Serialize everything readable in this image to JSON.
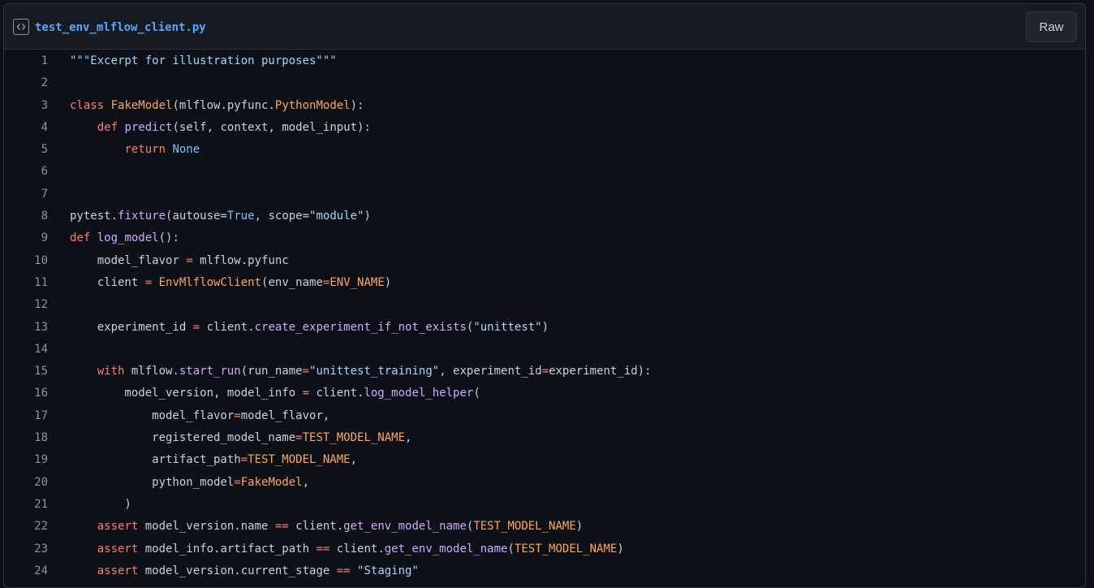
{
  "header": {
    "filename": "test_env_mlflow_client.py",
    "raw_label": "Raw",
    "file_icon": "code-icon"
  },
  "colors": {
    "background": "#0d1117",
    "header_bg": "#161b22",
    "border": "#30363d",
    "filename": "#58a6ff",
    "keyword": "#ff7b72",
    "function": "#d2a8ff",
    "class": "#ffa657",
    "string": "#a5d6ff",
    "constant": "#79c0ff",
    "text": "#c9d1d9",
    "line_number": "#8b949e"
  },
  "lines": [
    {
      "n": "1",
      "tokens": [
        {
          "t": "\"\"\"Excerpt for illustration purposes\"\"\"",
          "c": "str"
        }
      ]
    },
    {
      "n": "2",
      "tokens": []
    },
    {
      "n": "3",
      "tokens": [
        {
          "t": "class",
          "c": "kw"
        },
        {
          "t": " "
        },
        {
          "t": "FakeModel",
          "c": "cls"
        },
        {
          "t": "(mlflow.pyfunc."
        },
        {
          "t": "PythonModel",
          "c": "cls"
        },
        {
          "t": "):"
        }
      ]
    },
    {
      "n": "4",
      "tokens": [
        {
          "t": "    "
        },
        {
          "t": "def",
          "c": "kw"
        },
        {
          "t": " "
        },
        {
          "t": "predict",
          "c": "fn"
        },
        {
          "t": "(self, context, model_input):"
        }
      ]
    },
    {
      "n": "5",
      "tokens": [
        {
          "t": "        "
        },
        {
          "t": "return",
          "c": "kw"
        },
        {
          "t": " "
        },
        {
          "t": "None",
          "c": "const"
        }
      ]
    },
    {
      "n": "6",
      "tokens": []
    },
    {
      "n": "7",
      "tokens": []
    },
    {
      "n": "8",
      "tokens": [
        {
          "t": "pytest."
        },
        {
          "t": "fixture",
          "c": "fn"
        },
        {
          "t": "(autouse="
        },
        {
          "t": "True",
          "c": "const"
        },
        {
          "t": ", scope="
        },
        {
          "t": "\"module\"",
          "c": "str"
        },
        {
          "t": ")"
        }
      ]
    },
    {
      "n": "9",
      "tokens": [
        {
          "t": "def",
          "c": "kw"
        },
        {
          "t": " "
        },
        {
          "t": "log_model",
          "c": "fn"
        },
        {
          "t": "():"
        }
      ]
    },
    {
      "n": "10",
      "tokens": [
        {
          "t": "    model_flavor "
        },
        {
          "t": "=",
          "c": "kw"
        },
        {
          "t": " mlflow.pyfunc"
        }
      ]
    },
    {
      "n": "11",
      "tokens": [
        {
          "t": "    client "
        },
        {
          "t": "=",
          "c": "kw"
        },
        {
          "t": " "
        },
        {
          "t": "EnvMlflowClient",
          "c": "cls"
        },
        {
          "t": "(env_name"
        },
        {
          "t": "=",
          "c": "kw"
        },
        {
          "t": "ENV_NAME",
          "c": "cls"
        },
        {
          "t": ")"
        }
      ]
    },
    {
      "n": "12",
      "tokens": []
    },
    {
      "n": "13",
      "tokens": [
        {
          "t": "    experiment_id "
        },
        {
          "t": "=",
          "c": "kw"
        },
        {
          "t": " client."
        },
        {
          "t": "create_experiment_if_not_exists",
          "c": "fn"
        },
        {
          "t": "("
        },
        {
          "t": "\"unittest\"",
          "c": "str"
        },
        {
          "t": ")"
        }
      ]
    },
    {
      "n": "14",
      "tokens": []
    },
    {
      "n": "15",
      "tokens": [
        {
          "t": "    "
        },
        {
          "t": "with",
          "c": "kw"
        },
        {
          "t": " mlflow."
        },
        {
          "t": "start_run",
          "c": "fn"
        },
        {
          "t": "(run_name"
        },
        {
          "t": "=",
          "c": "kw"
        },
        {
          "t": "\"unittest_training\"",
          "c": "str"
        },
        {
          "t": ", experiment_id"
        },
        {
          "t": "=",
          "c": "kw"
        },
        {
          "t": "experiment_id):"
        }
      ]
    },
    {
      "n": "16",
      "tokens": [
        {
          "t": "        model_version, model_info "
        },
        {
          "t": "=",
          "c": "kw"
        },
        {
          "t": " client."
        },
        {
          "t": "log_model_helper",
          "c": "fn"
        },
        {
          "t": "("
        }
      ]
    },
    {
      "n": "17",
      "tokens": [
        {
          "t": "            model_flavor"
        },
        {
          "t": "=",
          "c": "kw"
        },
        {
          "t": "model_flavor,"
        }
      ]
    },
    {
      "n": "18",
      "tokens": [
        {
          "t": "            registered_model_name"
        },
        {
          "t": "=",
          "c": "kw"
        },
        {
          "t": "TEST_MODEL_NAME",
          "c": "cls"
        },
        {
          "t": ","
        }
      ]
    },
    {
      "n": "19",
      "tokens": [
        {
          "t": "            artifact_path"
        },
        {
          "t": "=",
          "c": "kw"
        },
        {
          "t": "TEST_MODEL_NAME",
          "c": "cls"
        },
        {
          "t": ","
        }
      ]
    },
    {
      "n": "20",
      "tokens": [
        {
          "t": "            python_model"
        },
        {
          "t": "=",
          "c": "kw"
        },
        {
          "t": "FakeModel",
          "c": "cls"
        },
        {
          "t": ","
        }
      ]
    },
    {
      "n": "21",
      "tokens": [
        {
          "t": "        )"
        }
      ]
    },
    {
      "n": "22",
      "tokens": [
        {
          "t": "    "
        },
        {
          "t": "assert",
          "c": "kw"
        },
        {
          "t": " model_version.name "
        },
        {
          "t": "==",
          "c": "kw"
        },
        {
          "t": " client."
        },
        {
          "t": "get_env_model_name",
          "c": "fn"
        },
        {
          "t": "("
        },
        {
          "t": "TEST_MODEL_NAME",
          "c": "cls"
        },
        {
          "t": ")"
        }
      ]
    },
    {
      "n": "23",
      "tokens": [
        {
          "t": "    "
        },
        {
          "t": "assert",
          "c": "kw"
        },
        {
          "t": " model_info.artifact_path "
        },
        {
          "t": "==",
          "c": "kw"
        },
        {
          "t": " client."
        },
        {
          "t": "get_env_model_name",
          "c": "fn"
        },
        {
          "t": "("
        },
        {
          "t": "TEST_MODEL_NAME",
          "c": "cls"
        },
        {
          "t": ")"
        }
      ]
    },
    {
      "n": "24",
      "tokens": [
        {
          "t": "    "
        },
        {
          "t": "assert",
          "c": "kw"
        },
        {
          "t": " model_version.current_stage "
        },
        {
          "t": "==",
          "c": "kw"
        },
        {
          "t": " "
        },
        {
          "t": "\"Staging\"",
          "c": "str"
        }
      ]
    }
  ]
}
